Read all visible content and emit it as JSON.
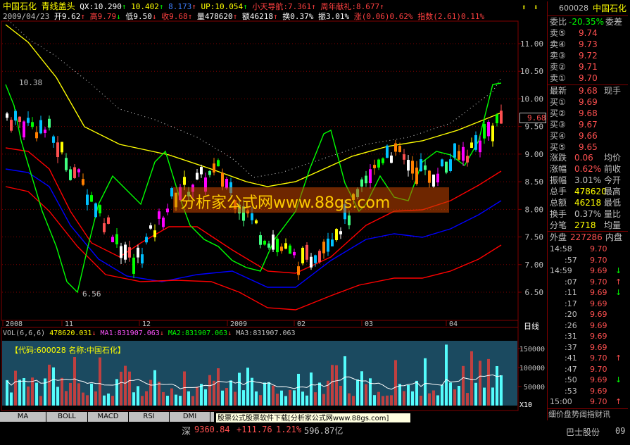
{
  "header": {
    "stock_name": "中国石化",
    "indicator_name": "青线盖头",
    "qx": "QX:10.290",
    "v1": "10.402",
    "v2": "8.173",
    "up": "UP:10.054",
    "xiaotian": "小天导航:7.361",
    "zhounian": "周年献礼:8.677",
    "date": "2009/04/23",
    "open": "开9.62",
    "high": "高9.79",
    "low": "低9.50",
    "close": "收9.68",
    "volume": "量478620",
    "amount": "额46218",
    "turnover": "换0.37%",
    "amplitude": "振3.01%",
    "change": "涨(0.06)0.62%",
    "index": "指数(2.61)0.11%"
  },
  "price_axis": [
    "11.00",
    "10.50",
    "10.00",
    "9.50",
    "9.00",
    "8.50",
    "8.00",
    "7.50",
    "7.00",
    "6.50"
  ],
  "current_price_tag": "9.68",
  "annotations": {
    "high_label": "10.38",
    "low_label": "6.56"
  },
  "date_axis": [
    "2008",
    "11",
    "12",
    "2009",
    "02",
    "03",
    "04"
  ],
  "period_label": "日线",
  "watermark": "分析家公式网www.88gs.com",
  "volume": {
    "header_name": "VOL(6,6,6)",
    "vol_value": "478620.031",
    "ma1": "MA1:831907.063",
    "ma2": "MA2:831907.063",
    "ma3": "MA3:831907.063",
    "code_label": "【代码:600028 名称:中国石化】",
    "axis": [
      "150000",
      "100000",
      "50000"
    ],
    "unit": "X10"
  },
  "tabs": [
    "MA",
    "BOLL",
    "MACD",
    "RSI",
    "DMI"
  ],
  "ad_banner": "股票公式股票软件下载[分析家公式网www.88gs.com]",
  "status_bar": {
    "index_name": "深",
    "index_value": "9360.84",
    "index_change": "+111.76",
    "index_pct": "1.21%",
    "index_amount": "596.87亿"
  },
  "right_panel": {
    "code": "600028",
    "name": "中国石化",
    "weibi_label": "委比",
    "weibi_value": "-20.35%",
    "weicha_label": "委差",
    "sells": [
      {
        "label": "卖⑤",
        "price": "9.74"
      },
      {
        "label": "卖④",
        "price": "9.73"
      },
      {
        "label": "卖③",
        "price": "9.72"
      },
      {
        "label": "卖②",
        "price": "9.71"
      },
      {
        "label": "卖①",
        "price": "9.70"
      }
    ],
    "latest_label": "最新",
    "latest_value": "9.68",
    "xianshou_label": "现手",
    "buys": [
      {
        "label": "买①",
        "price": "9.69"
      },
      {
        "label": "买②",
        "price": "9.68"
      },
      {
        "label": "买③",
        "price": "9.67"
      },
      {
        "label": "买④",
        "price": "9.66"
      },
      {
        "label": "买⑤",
        "price": "9.65"
      }
    ],
    "stats": [
      {
        "label": "涨跌",
        "value": "0.06",
        "extra": "均价"
      },
      {
        "label": "涨幅",
        "value": "0.62%",
        "extra": "前收"
      },
      {
        "label": "振幅",
        "value": "3.01%",
        "extra": "今开"
      },
      {
        "label": "总手",
        "value": "478620",
        "extra": "最高"
      },
      {
        "label": "总额",
        "value": "46218",
        "extra": "最低"
      },
      {
        "label": "换手",
        "value": "0.37%",
        "extra": "量比"
      },
      {
        "label": "分笔",
        "value": "2718",
        "extra": "均量"
      }
    ],
    "waipan_label": "外盘",
    "waipan_value": "227286",
    "neipan_label": "内盘",
    "ticks": [
      {
        "time": "14:58",
        "price": "9.70",
        "dir": ""
      },
      {
        "time": ":57",
        "price": "9.70",
        "dir": ""
      },
      {
        "time": "14:59",
        "price": "9.69",
        "dir": "↓"
      },
      {
        "time": ":07",
        "price": "9.70",
        "dir": "↑"
      },
      {
        "time": ":11",
        "price": "9.69",
        "dir": "↓"
      },
      {
        "time": ":17",
        "price": "9.69",
        "dir": ""
      },
      {
        "time": ":20",
        "price": "9.69",
        "dir": ""
      },
      {
        "time": ":26",
        "price": "9.69",
        "dir": ""
      },
      {
        "time": ":31",
        "price": "9.69",
        "dir": ""
      },
      {
        "time": ":37",
        "price": "9.69",
        "dir": ""
      },
      {
        "time": ":41",
        "price": "9.70",
        "dir": "↑"
      },
      {
        "time": ":47",
        "price": "9.70",
        "dir": ""
      },
      {
        "time": ":50",
        "price": "9.69",
        "dir": "↓"
      },
      {
        "time": ":53",
        "price": "9.69",
        "dir": ""
      },
      {
        "time": "15:00",
        "price": "9.70",
        "dir": "↑"
      }
    ],
    "bottom_label": "细价盘势阔指财讯",
    "bottom_right": "巴士股份",
    "bottom_right2": "09"
  },
  "colors": {
    "up": "#ff5050",
    "down": "#54fcfc",
    "yellow": "#ffff00",
    "green": "#00ff00",
    "red_band": "#ff0000",
    "blue_band": "#0000ff",
    "frame": "#800000"
  }
}
